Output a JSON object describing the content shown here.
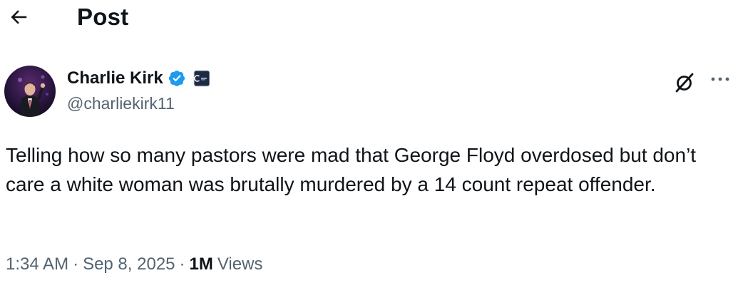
{
  "header": {
    "title": "Post",
    "back_icon": "arrow-left-icon"
  },
  "author": {
    "display_name": "Charlie Kirk",
    "handle": "@charliekirk11",
    "verified_color": "#1d9bf0",
    "affiliate_icon": "organization-badge-icon"
  },
  "actions": {
    "grok_icon": "grok-icon",
    "more_icon": "more-dots-icon"
  },
  "tweet": {
    "text": "Telling how so many pastors were mad that George Floyd overdosed but don’t care a white woman was brutally murdered by a 14 count repeat offender."
  },
  "meta": {
    "time": "1:34 AM",
    "separator": "·",
    "date": "Sep 8, 2025",
    "views_count": "1M",
    "views_label": "Views"
  },
  "colors": {
    "text_primary": "#0f1419",
    "text_secondary": "#536471",
    "accent": "#1d9bf0"
  }
}
